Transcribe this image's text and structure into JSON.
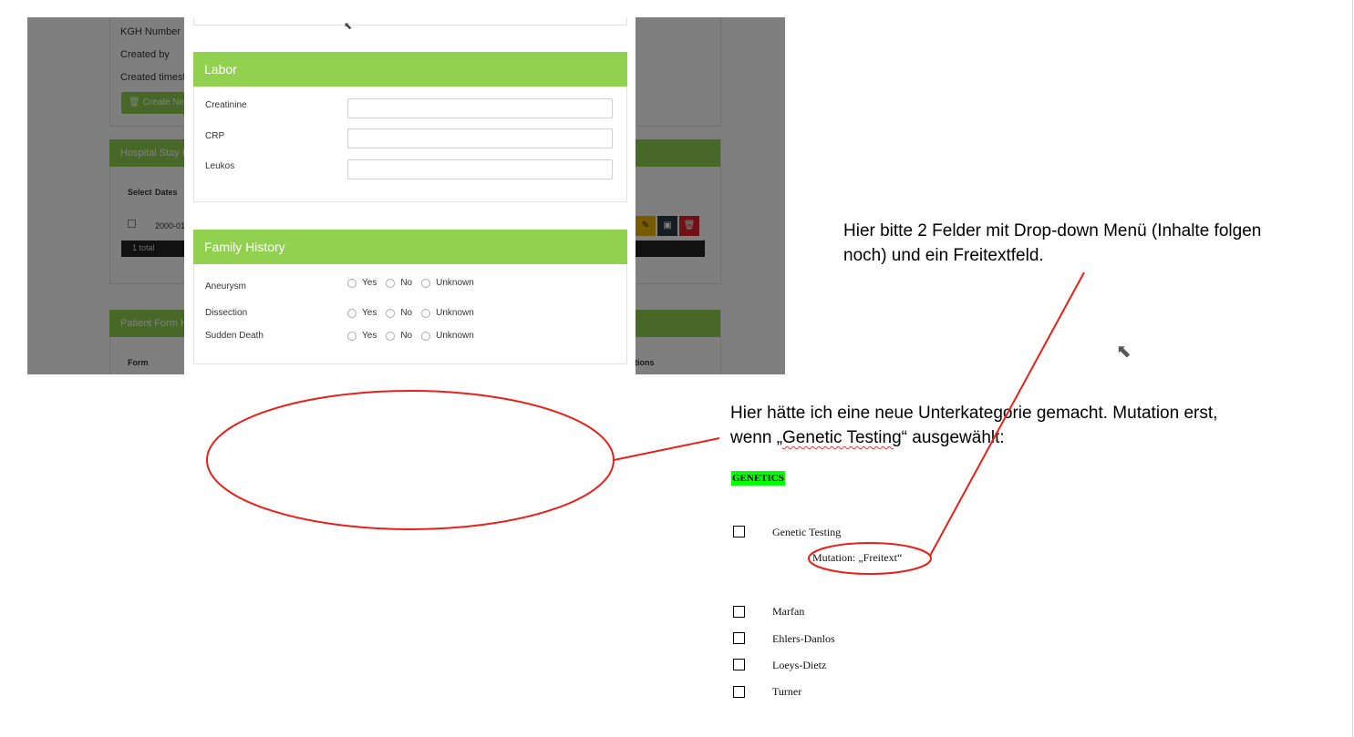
{
  "background_form": {
    "fields": [
      "KGH Number",
      "Created by",
      "Created timesta"
    ],
    "create_button": "Create Ne",
    "hospital_stay_header": "Hospital Stay H",
    "table_headers": [
      "Select",
      "Dates"
    ],
    "row_date": "2000-01-",
    "total": "1 total",
    "patient_form_header": "Patient Form Hi",
    "patient_form_col_form": "Form",
    "patient_form_col_actions": "tions"
  },
  "labor": {
    "title": "Labor",
    "fields": [
      {
        "label": "Creatinine",
        "value": ""
      },
      {
        "label": "CRP",
        "value": ""
      },
      {
        "label": "Leukos",
        "value": ""
      }
    ]
  },
  "family_history": {
    "title": "Family History",
    "rows": [
      {
        "label": "Aneurysm",
        "options": [
          "Yes",
          "No",
          "Unknown"
        ]
      },
      {
        "label": "Dissection",
        "options": [
          "Yes",
          "No",
          "Unknown"
        ]
      },
      {
        "label": "Sudden Death",
        "options": [
          "Yes",
          "No",
          "Unknown"
        ]
      }
    ]
  },
  "annotations": {
    "top_note_line1": "Hier bitte 2 Felder mit Drop-down Menü (Inhalte folgen",
    "top_note_line2": "noch) und ein Freitextfeld.",
    "mid_note_line1": "Hier hätte ich eine neue Unterkategorie gemacht. Mutation erst,",
    "mid_note_line2_pre": "wenn „",
    "mid_note_line2_term": "Genetic Testing",
    "mid_note_line2_post": "“ ausgewählt:",
    "genetics_tag": "GENETICS",
    "genetic_testing": "Genetic Testing",
    "mutation": "Mutation: „Freitext“",
    "conditions": [
      "Marfan",
      "Ehlers-Danlos",
      "Loeys-Dietz",
      "Turner"
    ]
  },
  "colors": {
    "header_green": "#92d050",
    "highlight_green": "#00ff00",
    "annotation_red": "#e8201a"
  }
}
